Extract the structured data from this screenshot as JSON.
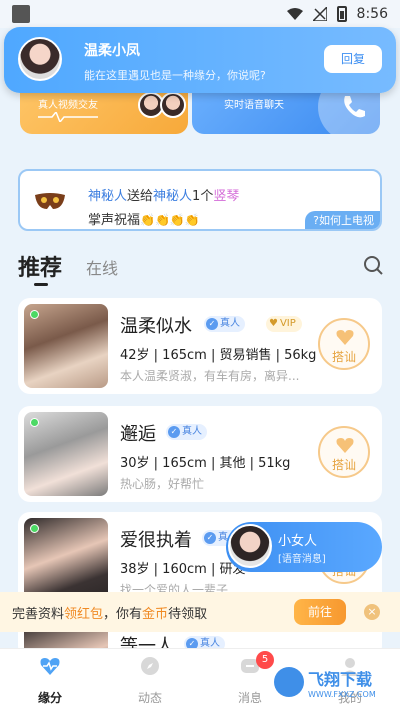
{
  "status_bar": {
    "time": "8:56"
  },
  "banners": {
    "left_tag": "真人视频交友",
    "right_tag": "实时语音聊天"
  },
  "notification": {
    "name": "温柔小凤",
    "message": "能在这里遇见也是一种缘分，你说呢?",
    "reply_label": "回复"
  },
  "gift_marquee": {
    "sender": "神秘人",
    "verb": "送给",
    "receiver": "神秘人",
    "count": "1个",
    "gift": "竖琴",
    "line2": "掌声祝福",
    "claps": "👏👏👏👏",
    "how_label": "?如何上电视"
  },
  "tabs": {
    "recommend": "推荐",
    "online": "在线"
  },
  "cards": [
    {
      "nick": "温柔似水",
      "real": "真人",
      "vip": "VIP",
      "info": "42岁 | 165cm | 贸易销售 | 56kg",
      "bio": "本人温柔贤淑，有车有房，离异...",
      "chat": "搭讪"
    },
    {
      "nick": "邂逅",
      "real": "真人",
      "info": "30岁 | 165cm | 其他 | 51kg",
      "bio": "热心肠，好帮忙",
      "chat": "搭讪"
    },
    {
      "nick": "爱很执着",
      "real": "真人",
      "info": "38岁 | 160cm | 研发",
      "bio": "找一个爱的人一辈子",
      "chat": "搭讪"
    },
    {
      "nick": "等一人",
      "real": "真人"
    }
  ],
  "voice_bubble": {
    "name": "小女人",
    "sub": "[语音消息]"
  },
  "reward_bar": {
    "prefix": "完善资料",
    "red": "领红包",
    "mid": "，你有",
    "gold": "金币",
    "suffix": "待领取",
    "go": "前往",
    "close": "×"
  },
  "nav": {
    "items": [
      {
        "label": "缘分"
      },
      {
        "label": "动态"
      },
      {
        "label": "消息",
        "badge": "5"
      },
      {
        "label": "我的"
      }
    ]
  },
  "watermark": {
    "line1": "飞翔下载",
    "line2": "WWW.FXXZ.COM"
  },
  "colors": {
    "accent": "#3d8ff2",
    "online": "#4cd964",
    "gold": "#f08a24",
    "badge": "#ff4a4a"
  }
}
